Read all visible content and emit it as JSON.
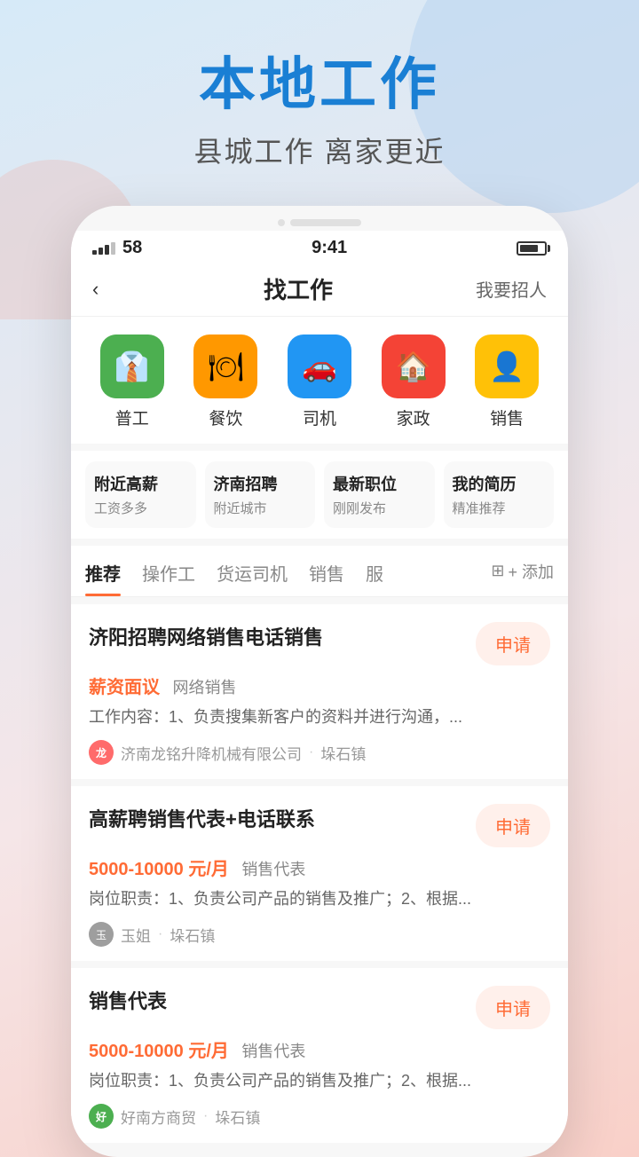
{
  "app": {
    "main_title": "本地工作",
    "sub_title": "县城工作  离家更近"
  },
  "status_bar": {
    "signal": "58",
    "time": "9:41"
  },
  "nav": {
    "back": "‹",
    "title": "找工作",
    "right": "我要招人"
  },
  "categories": [
    {
      "id": "general",
      "icon": "👔",
      "label": "普工",
      "color": "icon-green"
    },
    {
      "id": "food",
      "icon": "🍽",
      "label": "餐饮",
      "color": "icon-orange"
    },
    {
      "id": "driver",
      "icon": "🚗",
      "label": "司机",
      "color": "icon-blue"
    },
    {
      "id": "home",
      "icon": "🏠",
      "label": "家政",
      "color": "icon-red"
    },
    {
      "id": "sales",
      "icon": "👤",
      "label": "销售",
      "color": "icon-yellow"
    }
  ],
  "quick_links": [
    {
      "title": "附近高薪",
      "sub": "工资多多"
    },
    {
      "title": "济南招聘",
      "sub": "附近城市"
    },
    {
      "title": "最新职位",
      "sub": "刚刚发布"
    },
    {
      "title": "我的简历",
      "sub": "精准推荐"
    }
  ],
  "tabs": [
    {
      "label": "推荐",
      "active": true
    },
    {
      "label": "操作工",
      "active": false
    },
    {
      "label": "货运司机",
      "active": false
    },
    {
      "label": "销售",
      "active": false
    },
    {
      "label": "服",
      "active": false
    }
  ],
  "tab_add": "+ 添加",
  "jobs": [
    {
      "title": "济阳招聘网络销售电话销售",
      "salary": "薪资面议",
      "salary_type": "negotiable",
      "job_type": "网络销售",
      "desc": "工作内容：1、负责搜集新客户的资料并进行沟通，...",
      "company": "济南龙铭升降机械有限公司",
      "location": "垛石镇",
      "apply_label": "申请",
      "avatar_text": "龙",
      "avatar_class": "avatar-red"
    },
    {
      "title": "高薪聘销售代表+电话联系",
      "salary": "5000-10000 元/月",
      "salary_type": "range",
      "job_type": "销售代表",
      "desc": "岗位职责：1、负责公司产品的销售及推广；2、根据...",
      "company": "玉姐",
      "location": "垛石镇",
      "apply_label": "申请",
      "avatar_text": "玉",
      "avatar_class": "avatar-gray"
    },
    {
      "title": "销售代表",
      "salary": "5000-10000 元/月",
      "salary_type": "range",
      "job_type": "销售代表",
      "desc": "岗位职责：1、负责公司产品的销售及推广；2、根据...",
      "company": "好南方商贸",
      "location": "垛石镇",
      "apply_label": "申请",
      "avatar_text": "好",
      "avatar_class": "avatar-green"
    }
  ]
}
